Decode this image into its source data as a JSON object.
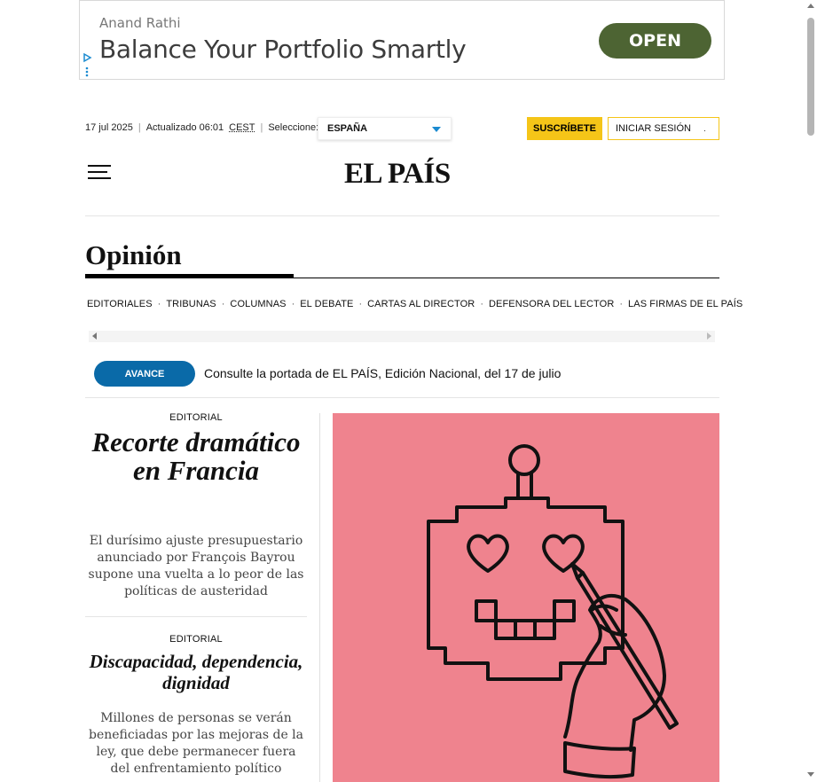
{
  "ad": {
    "advertiser": "Anand Rathi",
    "headline": "Balance Your Portfolio Smartly",
    "cta": "OPEN",
    "cta_color": "#4d6433"
  },
  "topbar": {
    "date": "17 jul 2025",
    "updated": "Actualizado 06:01",
    "timezone": "CEST",
    "select_label": "Seleccione:",
    "region": "ESPAÑA",
    "subscribe": "SUSCRÍBETE",
    "login": "INICIAR SESIÓN",
    "login_caret": "·"
  },
  "masthead": {
    "logo": "EL PAÍS"
  },
  "section": {
    "title": "Opinión",
    "subnav": [
      "EDITORIALES",
      "TRIBUNAS",
      "COLUMNAS",
      "EL DEBATE",
      "CARTAS AL DIRECTOR",
      "DEFENSORA DEL LECTOR",
      "LAS FIRMAS DE EL PAÍS"
    ]
  },
  "advance": {
    "button": "AVANCE",
    "text": "Consulte la portada de EL PAÍS, Edición Nacional, del 17 de julio",
    "button_color": "#0a6aa8"
  },
  "articles": [
    {
      "kicker": "EDITORIAL",
      "headline": "Recorte dramático en Francia",
      "summary": "El durísimo ajuste presupuestario anunciado por François Bayrou supone una vuelta a lo peor de las políticas de austeridad"
    },
    {
      "kicker": "EDITORIAL",
      "headline": "Discapacidad, dependencia, dignidad",
      "summary": "Millones de personas se verán beneficiadas por las mejoras de la ley, que debe permanecer fuera del enfrentamiento político"
    }
  ],
  "illustration": {
    "icon": "robot-with-hand-drawing-heart-eyes",
    "background": "#ef838e"
  },
  "colors": {
    "subscribe": "#f5c518",
    "accent_blue": "#1a8ad0"
  }
}
